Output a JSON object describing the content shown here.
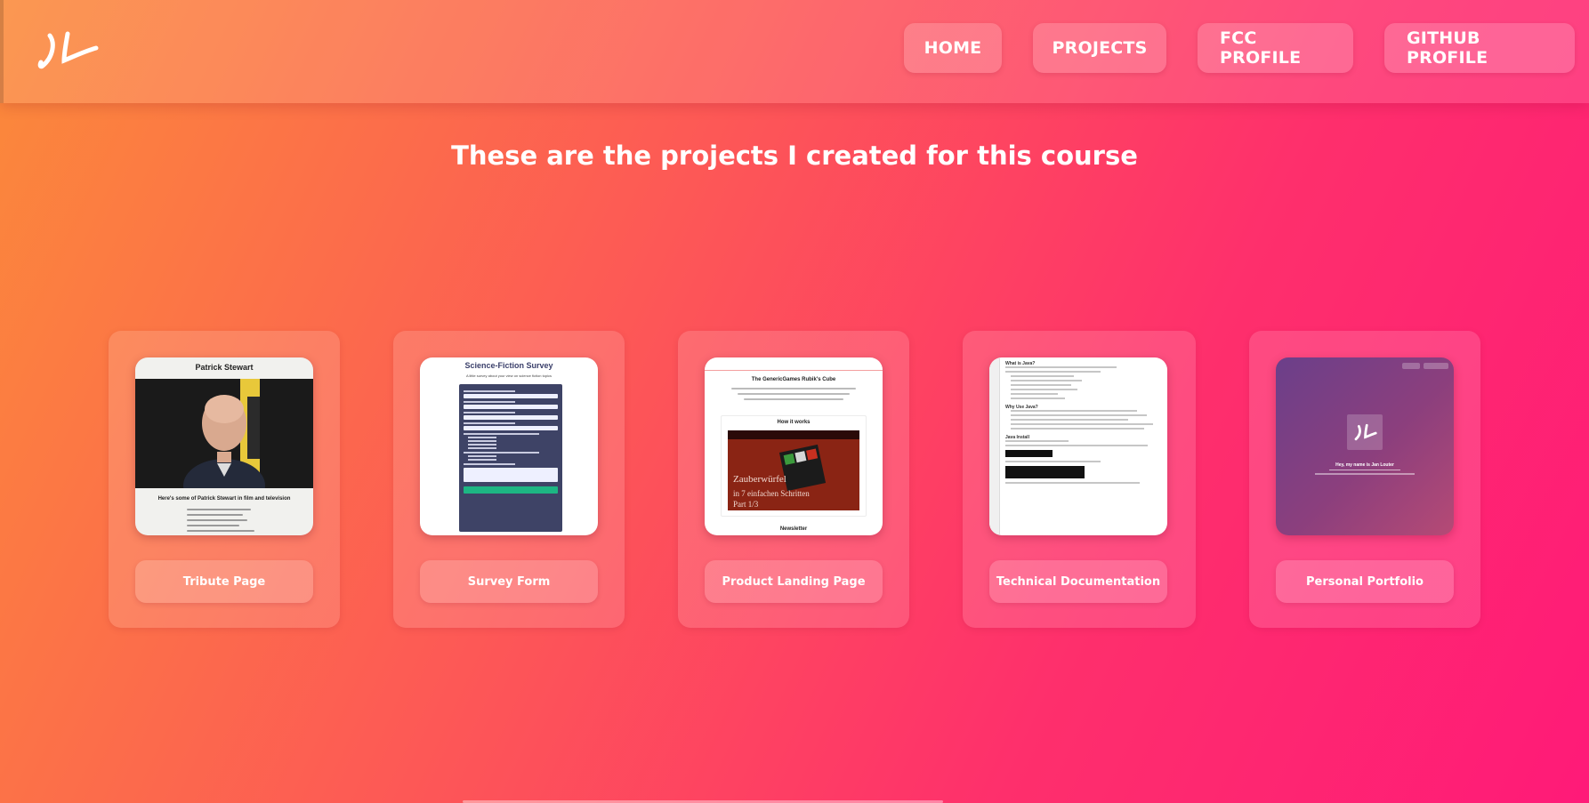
{
  "header": {
    "logo_icon": "jl-signature-logo-icon",
    "nav": [
      {
        "label": "HOME"
      },
      {
        "label": "PROJECTS"
      },
      {
        "label": "FCC PROFILE"
      },
      {
        "label": "GITHUB PROFILE"
      }
    ]
  },
  "main": {
    "title": "These are the projects I created for this course"
  },
  "projects": [
    {
      "label": "Tribute Page",
      "thumb": {
        "title": "Patrick Stewart",
        "subtitle": "Here's some of Patrick Stewart in film and television"
      }
    },
    {
      "label": "Survey Form",
      "thumb": {
        "title": "Science-Fiction Survey",
        "subtitle": "A little survey about your view on science fiction topics"
      }
    },
    {
      "label": "Product Landing Page",
      "thumb": {
        "title": "The GenericGames Rubik's Cube",
        "subtitle": "How it works",
        "video_text": "Zauberwürfel lösen in 7 einfachen Schritten Part 1/3",
        "footer": "Newsletter"
      }
    },
    {
      "label": "Technical Documentation",
      "thumb": {
        "heading1": "What is Java?",
        "heading2": "Why Use Java?",
        "heading3": "Java Install"
      }
    },
    {
      "label": "Personal Portfolio",
      "thumb": {
        "nav": [
          "HOME",
          "PROJECTS"
        ],
        "name": "Hey, my name is Jan Louter"
      }
    }
  ],
  "colors": {
    "gradient_start": "#fb8a3a",
    "gradient_mid": "#fd5a55",
    "gradient_end": "#ff1a78",
    "text": "#ffffff"
  }
}
